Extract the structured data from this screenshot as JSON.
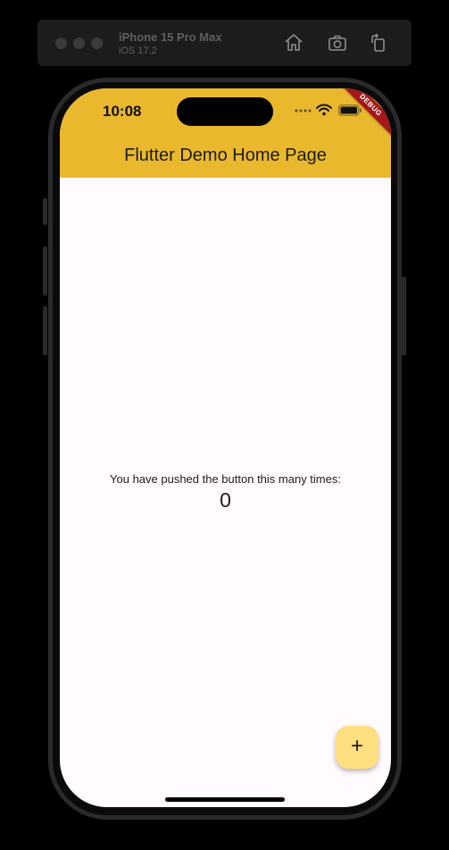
{
  "simulator": {
    "device_name": "iPhone 15 Pro Max",
    "os_version": "iOS 17.2",
    "toolbar_icons": [
      "home-icon",
      "screenshot-icon",
      "rotate-icon"
    ]
  },
  "status_bar": {
    "time": "10:08",
    "icons": [
      "signal-icon",
      "wifi-icon",
      "battery-icon"
    ]
  },
  "app_bar": {
    "title": "Flutter Demo Home Page",
    "color": "#eab82d"
  },
  "debug_banner": "DEBUG",
  "body": {
    "counter_label": "You have pushed the button this many times:",
    "counter_value": "0"
  },
  "fab": {
    "label": "+",
    "icon": "plus-icon",
    "color": "#ffdf80"
  },
  "colors": {
    "screen_background": "#fffbfe",
    "debug_banner": "#a5171a"
  }
}
